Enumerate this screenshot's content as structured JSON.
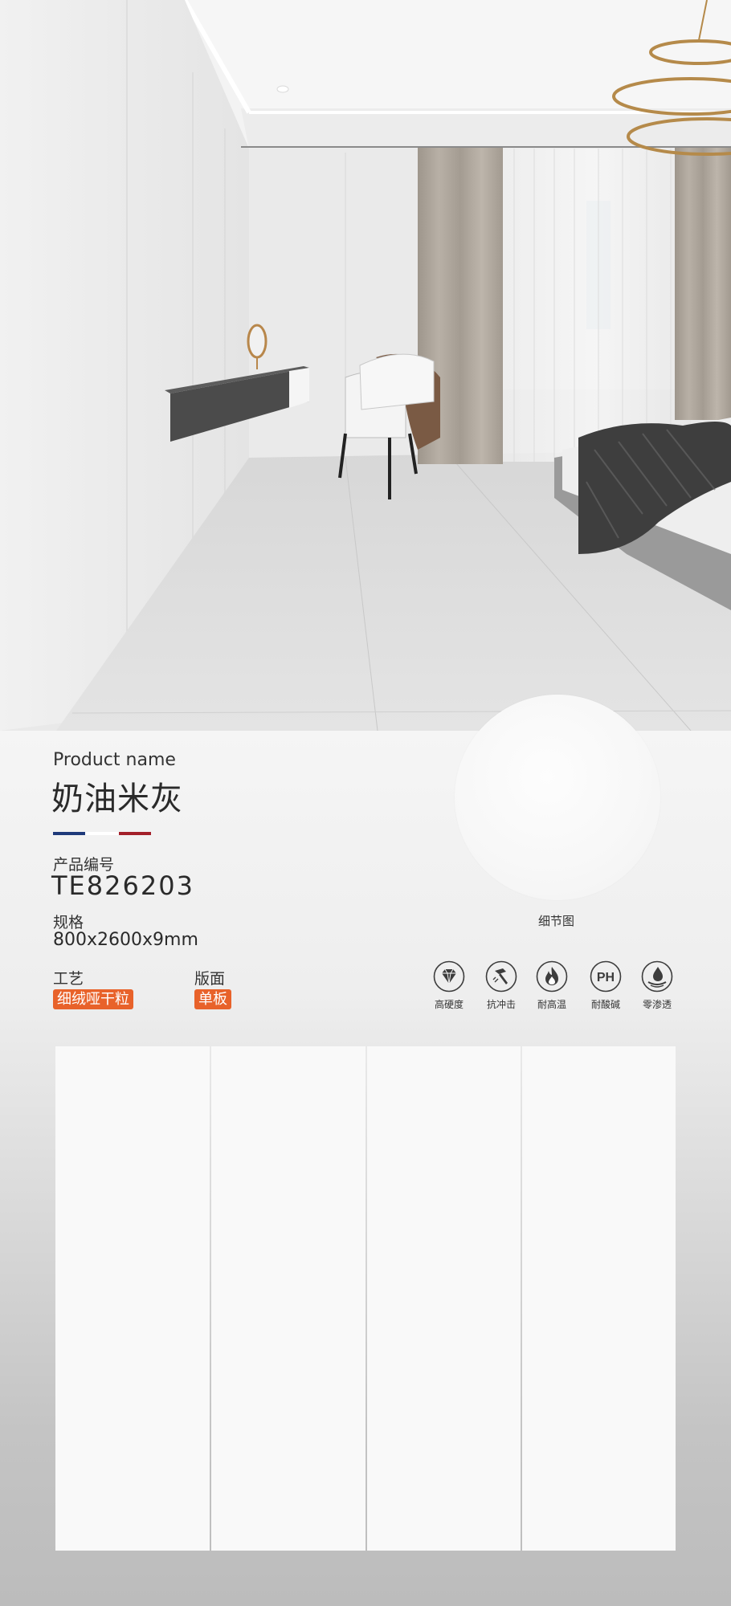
{
  "product": {
    "label_en": "Product name",
    "name": "奶油米灰",
    "code_label": "产品编号",
    "code": "TE826203",
    "spec_label": "规格",
    "spec": "800x2600x9mm",
    "craft_label": "工艺",
    "craft_value": "细绒哑干粒",
    "face_label": "版面",
    "face_value": "单板"
  },
  "detail": {
    "caption": "细节图"
  },
  "features": [
    {
      "icon": "diamond-icon",
      "label": "高硬度"
    },
    {
      "icon": "hammer-icon",
      "label": "抗冲击"
    },
    {
      "icon": "flame-icon",
      "label": "耐高温"
    },
    {
      "icon": "ph-icon",
      "label": "耐酸碱",
      "glyph": "PH"
    },
    {
      "icon": "water-drop-icon",
      "label": "零渗透"
    }
  ],
  "colors": {
    "accent_orange": "#e8622a",
    "flag_blue": "#1f3a7a",
    "flag_white": "#ffffff",
    "flag_red": "#a3202a",
    "icon_gray": "#3c3c3c"
  }
}
